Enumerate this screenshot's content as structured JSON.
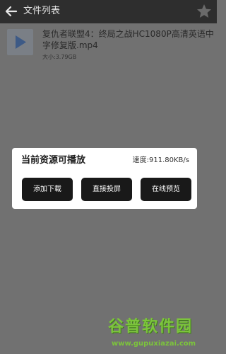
{
  "header": {
    "title": "文件列表",
    "back_icon": "back-arrow-icon",
    "star_icon": "star-icon"
  },
  "file": {
    "name": "复仇者联盟4：终局之战HC1080P高清英语中字修复版.mp4",
    "size": "大小:3.79GB",
    "icon": "video-play-icon"
  },
  "modal": {
    "title": "当前资源可播放",
    "speed": "速度:911.80KB/s",
    "buttons": {
      "download": "添加下载",
      "cast": "直接投屏",
      "preview": "在线预览"
    }
  },
  "watermark": {
    "logo_text": "谷普软件园",
    "url": "www.gupuxiazai.com"
  },
  "colors": {
    "topbar": "#2e2e2e",
    "overlay": "#717171",
    "button": "#191919",
    "watermark": "#7cc43c"
  }
}
